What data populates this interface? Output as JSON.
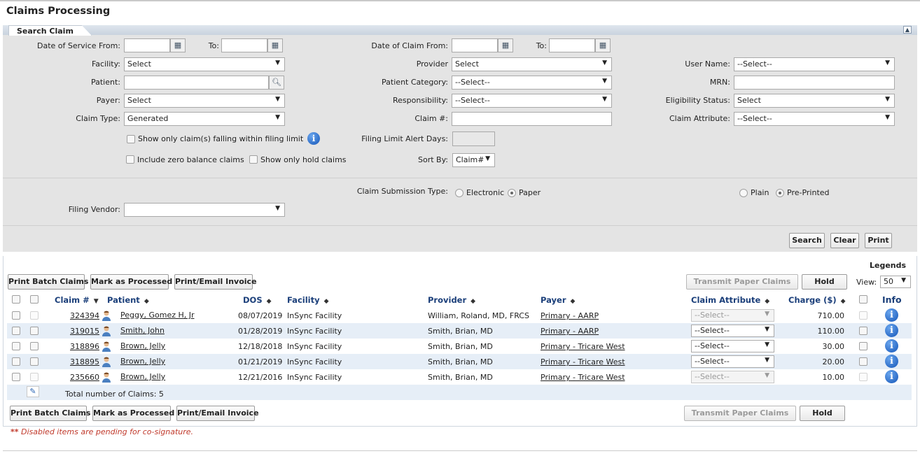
{
  "page": {
    "title": "Claims Processing"
  },
  "search": {
    "tab_label": "Search Claim",
    "collapse_icon": "chevron-up-icon",
    "dos_from_label": "Date of Service From:",
    "dos_to_label": "To:",
    "doc_from_label": "Date of Claim From:",
    "doc_to_label": "To:",
    "facility_label": "Facility:",
    "facility_value": "Select",
    "provider_label": "Provider",
    "provider_value": "Select",
    "username_label": "User Name:",
    "username_value": "--Select--",
    "patient_label": "Patient:",
    "patient_category_label": "Patient Category:",
    "patient_category_value": "--Select--",
    "mrn_label": "MRN:",
    "payer_label": "Payer:",
    "payer_value": "Select",
    "responsibility_label": "Responsibility:",
    "responsibility_value": "--Select--",
    "eligibility_label": "Eligibility Status:",
    "eligibility_value": "Select",
    "claim_type_label": "Claim Type:",
    "claim_type_value": "Generated",
    "claim_no_label": "Claim #:",
    "claim_attribute_label": "Claim Attribute:",
    "claim_attribute_value": "--Select--",
    "filing_limit_check": "Show only claim(s) falling within filing limit",
    "filing_limit_alert_label": "Filing Limit Alert Days:",
    "zero_balance_check": "Include zero balance claims",
    "hold_check": "Show only hold claims",
    "sort_by_label": "Sort By:",
    "sort_by_value": "Claim#",
    "submission_type_label": "Claim Submission Type:",
    "electronic_label": "Electronic",
    "paper_label": "Paper",
    "plain_label": "Plain",
    "preprinted_label": "Pre-Printed",
    "filing_vendor_label": "Filing Vendor:",
    "filing_vendor_value": "",
    "search_btn": "Search",
    "clear_btn": "Clear",
    "print_btn": "Print"
  },
  "results": {
    "legends_label": "Legends",
    "print_batch_btn": "Print Batch Claims",
    "mark_processed_btn": "Mark as Processed",
    "print_email_btn": "Print/Email Invoice",
    "transmit_btn": "Transmit Paper Claims",
    "hold_btn": "Hold",
    "view_label": "View:",
    "view_value": "50",
    "columns": {
      "claim": "Claim #",
      "patient": "Patient",
      "dos": "DOS",
      "facility": "Facility",
      "provider": "Provider",
      "payer": "Payer",
      "claim_attribute": "Claim Attribute",
      "charge": "Charge ($)",
      "info": "Info"
    },
    "rows": [
      {
        "claim": "324394",
        "patient": "Peggy, Gomez H, Jr",
        "dos": "08/07/2019",
        "facility": "InSync Facility",
        "provider": "William, Roland, MD, FRCS",
        "payer": "Primary - AARP",
        "attribute": "--Select--",
        "charge": "710.00",
        "disabled": true
      },
      {
        "claim": "319015",
        "patient": "Smith, John",
        "dos": "01/28/2019",
        "facility": "InSync Facility",
        "provider": "Smith, Brian, MD",
        "payer": "Primary - AARP",
        "attribute": "--Select--",
        "charge": "110.00",
        "disabled": false
      },
      {
        "claim": "318896",
        "patient": "Brown, Jelly",
        "dos": "12/18/2018",
        "facility": "InSync Facility",
        "provider": "Smith, Brian, MD",
        "payer": "Primary - Tricare West",
        "attribute": "--Select--",
        "charge": "30.00",
        "disabled": false
      },
      {
        "claim": "318895",
        "patient": "Brown, Jelly",
        "dos": "01/21/2019",
        "facility": "InSync Facility",
        "provider": "Smith, Brian, MD",
        "payer": "Primary - Tricare West",
        "attribute": "--Select--",
        "charge": "20.00",
        "disabled": false
      },
      {
        "claim": "235660",
        "patient": "Brown, Jelly",
        "dos": "12/21/2016",
        "facility": "InSync Facility",
        "provider": "Smith, Brian, MD",
        "payer": "Primary - Tricare West",
        "attribute": "--Select--",
        "charge": "10.00",
        "disabled": true
      }
    ],
    "total_label": "Total number of Claims: 5",
    "note": "Disabled items are pending for co-signature.",
    "note_prefix": "**"
  }
}
